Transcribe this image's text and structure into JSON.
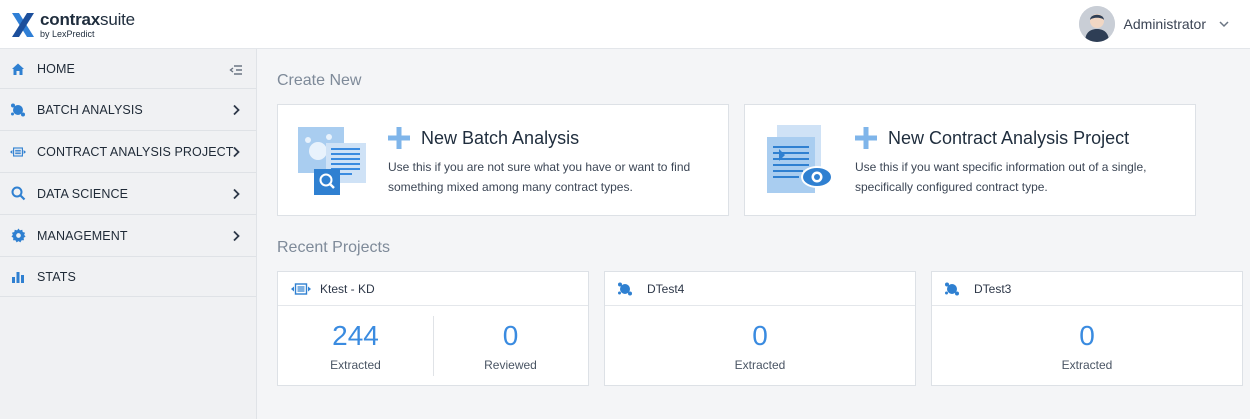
{
  "header": {
    "logo": {
      "name_bold": "contrax",
      "name_light": "suite",
      "byline": "by LexPredict"
    },
    "user": {
      "name": "Administrator"
    }
  },
  "sidebar": {
    "items": [
      {
        "label": "HOME",
        "icon": "home-icon",
        "right": "collapse-icon"
      },
      {
        "label": "BATCH ANALYSIS",
        "icon": "batch-analysis-icon",
        "right": "chevron-right-icon"
      },
      {
        "label": "CONTRACT ANALYSIS PROJECT",
        "icon": "contract-analysis-icon",
        "right": "chevron-right-icon"
      },
      {
        "label": "DATA SCIENCE",
        "icon": "search-icon",
        "right": "chevron-right-icon"
      },
      {
        "label": "MANAGEMENT",
        "icon": "gear-icon",
        "right": "chevron-right-icon"
      },
      {
        "label": "STATS",
        "icon": "bar-chart-icon",
        "right": ""
      }
    ]
  },
  "main": {
    "create_title": "Create New",
    "create_cards": [
      {
        "title": "New Batch Analysis",
        "description": "Use this if you are not sure what you have or want to find something mixed among many contract types."
      },
      {
        "title": "New Contract Analysis Project",
        "description": "Use this if you want specific information out of a single, specifically configured contract type."
      }
    ],
    "recent_title": "Recent Projects",
    "projects": [
      {
        "name": "Ktest - KD",
        "icon": "contract-analysis-icon",
        "stats": [
          {
            "value": "244",
            "label": "Extracted"
          },
          {
            "value": "0",
            "label": "Reviewed"
          }
        ]
      },
      {
        "name": "DTest4",
        "icon": "batch-analysis-icon",
        "stats": [
          {
            "value": "0",
            "label": "Extracted"
          }
        ]
      },
      {
        "name": "DTest3",
        "icon": "batch-analysis-icon",
        "stats": [
          {
            "value": "0",
            "label": "Extracted"
          }
        ]
      }
    ]
  },
  "colors": {
    "accent": "#2f80d1",
    "stat_value": "#3a8be0",
    "plus": "#7fb5ea",
    "illus_light": "#cfe2f6"
  }
}
